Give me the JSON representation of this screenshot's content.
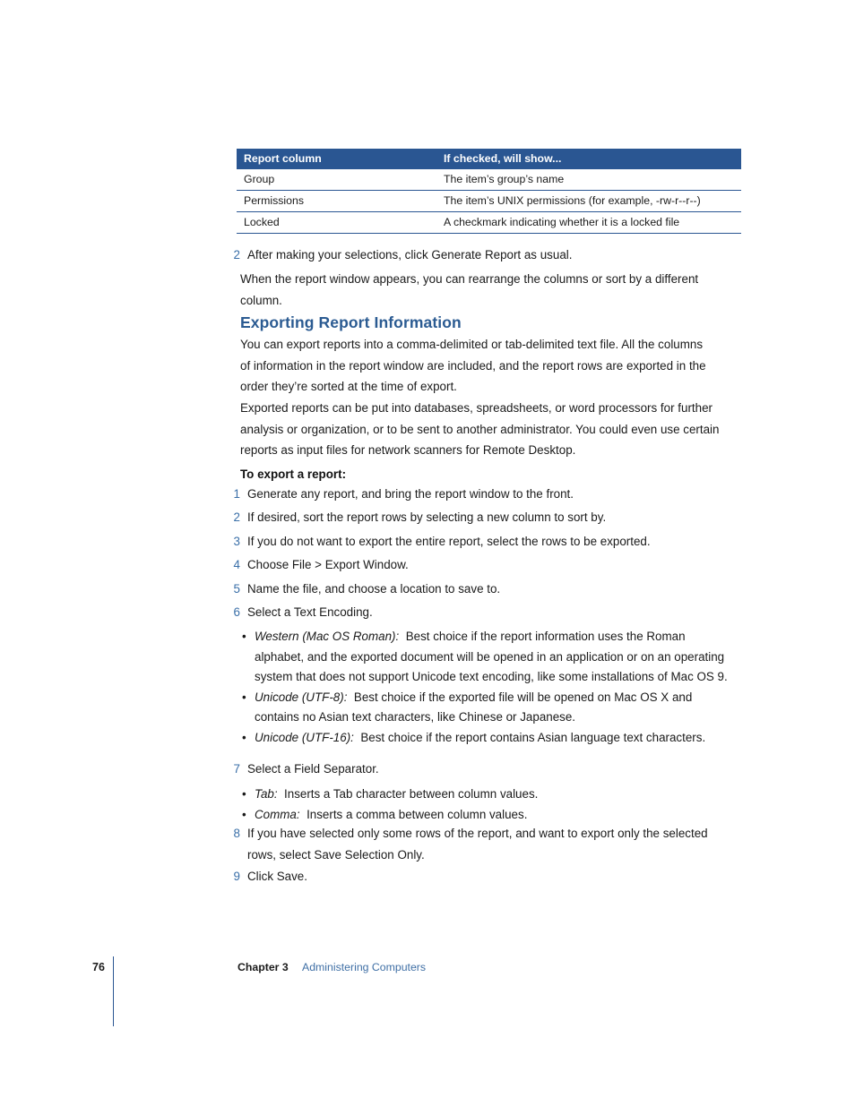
{
  "table": {
    "headers": [
      "Report column",
      "If checked, will show..."
    ],
    "rows": [
      [
        "Group",
        "The item’s group’s name"
      ],
      [
        "Permissions",
        "The item’s UNIX permissions (for example, -rw-r--r--)"
      ],
      [
        "Locked",
        "A checkmark indicating whether it is a locked file"
      ]
    ],
    "header_bg": "#2a5692",
    "rule_color": "#2a5692"
  },
  "intro": {
    "step2_num": "2",
    "step2_text": "After making your selections, click Generate Report as usual.",
    "followup": "When the report window appears, you can rearrange the columns or sort by a different column."
  },
  "section": {
    "heading": "Exporting Report Information",
    "heading_color": "#2b5b92",
    "para1": "You can export reports into a comma-delimited or tab-delimited text file. All the columns of information in the report window are included, and the report rows are exported in the order they’re sorted at the time of export.",
    "para2": "Exported reports can be put into databases, spreadsheets, or word processors for further analysis or organization, or to be sent to another administrator. You could even use certain reports as input files for network scanners for Remote Desktop."
  },
  "procedure": {
    "title": "To export a report:",
    "steps": [
      {
        "num": "1",
        "text": "Generate any report, and bring the report window to the front."
      },
      {
        "num": "2",
        "text": "If desired, sort the report rows by selecting a new column to sort by."
      },
      {
        "num": "3",
        "text": "If you do not want to export the entire report, select the rows to be exported."
      },
      {
        "num": "4",
        "text": "Choose File > Export Window."
      },
      {
        "num": "5",
        "text": "Name the file, and choose a location to save to."
      },
      {
        "num": "6",
        "text": "Select a Text Encoding."
      },
      {
        "num": "7",
        "text": "Select a Field Separator."
      },
      {
        "num": "8",
        "text": "If you have selected only some rows of the report, and want to export only the selected rows, select Save Selection Only."
      },
      {
        "num": "9",
        "text": "Click Save."
      }
    ],
    "encoding_bullets": [
      {
        "term": "Western (Mac OS Roman):",
        "desc": "Best choice if the report information uses the Roman alphabet, and the exported document will be opened in an application or on an operating system that does not support Unicode text encoding, like some installations of Mac OS 9."
      },
      {
        "term": "Unicode (UTF-8):",
        "desc": "Best choice if the exported file will be opened on Mac OS X and contains no Asian text characters, like Chinese or Japanese."
      },
      {
        "term": "Unicode (UTF-16):",
        "desc": "Best choice if the report contains Asian language text characters."
      }
    ],
    "separator_bullets": [
      {
        "term": "Tab:",
        "desc": "Inserts a Tab character between column values."
      },
      {
        "term": "Comma:",
        "desc": "Inserts a comma between column values."
      }
    ],
    "bullet_glyph": "•",
    "number_color": "#3a6fa8"
  },
  "footer": {
    "page_number": "76",
    "chapter_label": "Chapter 3",
    "chapter_title": "Administering Computers",
    "title_color": "#3f6fa5",
    "rule_color": "#2a5692"
  }
}
